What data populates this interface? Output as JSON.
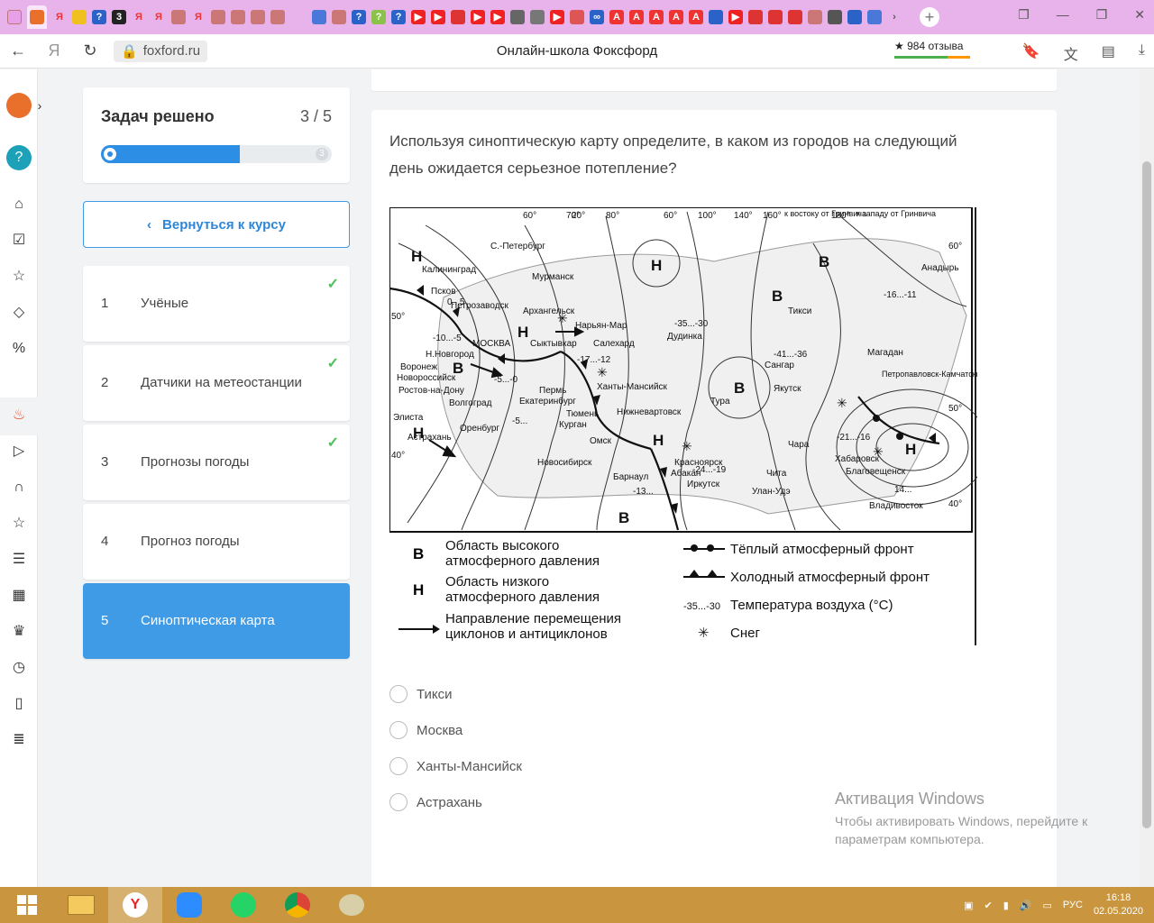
{
  "browser": {
    "url": "foxford.ru",
    "page_title": "Онлайн-школа Фоксфорд",
    "reviews": "★ 984 отзыва"
  },
  "progress": {
    "title": "Задач решено",
    "count": "3 / 5",
    "end_marker": "3",
    "fraction": 0.6
  },
  "back_button": "Вернуться к курсу",
  "lessons": [
    {
      "num": "1",
      "label": "Учёные",
      "done": true
    },
    {
      "num": "2",
      "label": "Датчики на метеостанции",
      "done": true
    },
    {
      "num": "3",
      "label": "Прогнозы погоды",
      "done": true
    },
    {
      "num": "4",
      "label": "Прогноз погоды",
      "done": false
    },
    {
      "num": "5",
      "label": "Синоптическая карта",
      "done": false,
      "active": true
    }
  ],
  "question": "Используя синоптическую карту определите, в каком из городов на следующий день ожидается серьезное потепление?",
  "map": {
    "cities": [
      "Калининград",
      "С.-Петербург",
      "Мурманск",
      "Псков",
      "Петрозаводск",
      "Архангельск",
      "Нарьян-Мар",
      "Дудинка",
      "Сыктывкар",
      "Салехард",
      "МОСКВА",
      "Н.Новгород",
      "Воронеж",
      "Новороссийск",
      "Ростов-на-Дону",
      "Волгоград",
      "Элиста",
      "Астрахань",
      "Оренбург",
      "Пермь",
      "Екатеринбург",
      "Тюмень",
      "Ханты-Мансийск",
      "Курган",
      "Омск",
      "Нижневартовск",
      "Новосибирск",
      "Барнаул",
      "Красноярск",
      "Абакан",
      "Иркутск",
      "Улан-Удэ",
      "Чита",
      "Тура",
      "Тикси",
      "Сангар",
      "Якутск",
      "Магадан",
      "Анадырь",
      "Петропавловск-Камчатский",
      "Хабаровск",
      "Благовещенск",
      "Владивосток",
      "Чара"
    ],
    "grid_labels": [
      "60°",
      "70°",
      "20°",
      "80°",
      "60°",
      "100°",
      "140°",
      "160°",
      "к востоку от Гринвича",
      "180°",
      "к западу от Гринвича",
      "60°",
      "50°",
      "40°",
      "50°",
      "40°"
    ],
    "temps": [
      "-35...-30",
      "-16...-11",
      "-41...-36",
      "-21...-16",
      "-24...-19",
      "-17...-12",
      "-5...-0",
      "0...5",
      "-13...",
      "14...",
      "-5...",
      "-10...-5"
    ],
    "legend": {
      "high": {
        "symbol": "B",
        "text": "Область высокого атмосферного давления"
      },
      "low": {
        "symbol": "Н",
        "text": "Область низкого атмосферного давления"
      },
      "arrow": "Направление перемещения циклонов и антициклонов",
      "warm": "Тёплый атмосферный фронт",
      "cold": "Холодный атмосферный фронт",
      "temp_sample": "-35...-30",
      "temp": "Температура воздуха (°С)",
      "snow": "Снег"
    }
  },
  "answers": [
    "Тикси",
    "Москва",
    "Ханты-Мансийск",
    "Астрахань"
  ],
  "activation": {
    "title": "Активация Windows",
    "subtitle": "Чтобы активировать Windows, перейдите к параметрам компьютера."
  },
  "taskbar": {
    "lang": "РУС",
    "time": "16:18",
    "date": "02.05.2020"
  }
}
